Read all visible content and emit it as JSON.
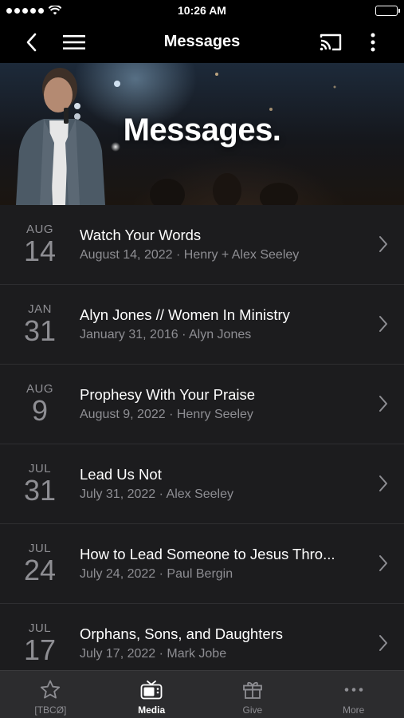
{
  "status": {
    "time": "10:26 AM"
  },
  "nav": {
    "title": "Messages"
  },
  "hero": {
    "title": "Messages."
  },
  "messages": [
    {
      "month": "AUG",
      "day": "14",
      "title": "Watch Your Words",
      "subtitle": "August 14, 2022 · Henry + Alex Seeley"
    },
    {
      "month": "JAN",
      "day": "31",
      "title": "Alyn Jones // Women In Ministry",
      "subtitle": "January 31, 2016 · Alyn Jones"
    },
    {
      "month": "AUG",
      "day": "9",
      "title": "Prophesy With Your Praise",
      "subtitle": "August 9, 2022 · Henry Seeley"
    },
    {
      "month": "JUL",
      "day": "31",
      "title": "Lead Us Not",
      "subtitle": "July 31, 2022 · Alex Seeley"
    },
    {
      "month": "JUL",
      "day": "24",
      "title": "How to Lead Someone to Jesus Thro...",
      "subtitle": "July 24, 2022 · Paul Bergin"
    },
    {
      "month": "JUL",
      "day": "17",
      "title": "Orphans, Sons, and Daughters",
      "subtitle": "July 17, 2022 · Mark Jobe"
    }
  ],
  "tabs": [
    {
      "label": "[TBCØ]",
      "icon": "star-icon"
    },
    {
      "label": "Media",
      "icon": "tv-icon"
    },
    {
      "label": "Give",
      "icon": "gift-icon"
    },
    {
      "label": "More",
      "icon": "more-dots-icon"
    }
  ],
  "colors": {
    "background": "#1c1c1e",
    "bar": "#000000",
    "tab_bar": "#2c2c2e",
    "secondary_text": "#8e8e93"
  }
}
